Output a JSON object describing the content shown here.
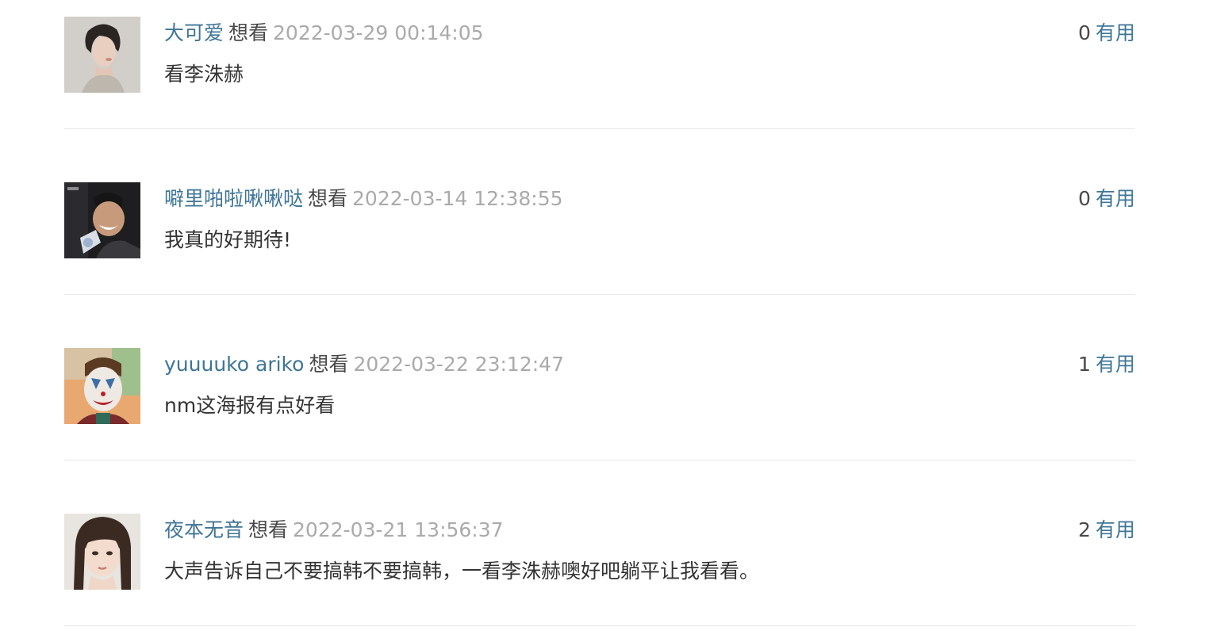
{
  "comments": [
    {
      "user": "大可爱",
      "status": "想看",
      "time": "2022-03-29 00:14:05",
      "votes": "0",
      "vote_label": "有用",
      "text": "看李洙赫",
      "avatar_icon": "avatar-photo-woman-profile"
    },
    {
      "user": "噼里啪啦啾啾哒",
      "status": "想看",
      "time": "2022-03-14 12:38:55",
      "votes": "0",
      "vote_label": "有用",
      "text": "我真的好期待!",
      "avatar_icon": "avatar-photo-laughing-man"
    },
    {
      "user": "yuuuuko ariko",
      "status": "想看",
      "time": "2022-03-22 23:12:47",
      "votes": "1",
      "vote_label": "有用",
      "text": "nm这海报有点好看",
      "avatar_icon": "avatar-photo-clown-face"
    },
    {
      "user": "夜本无音",
      "status": "想看",
      "time": "2022-03-21 13:56:37",
      "votes": "2",
      "vote_label": "有用",
      "text": "大声告诉自己不要搞韩不要搞韩，一看李洙赫噢好吧躺平让我看看。",
      "avatar_icon": "avatar-photo-woman-face"
    }
  ],
  "colors": {
    "link": "#3e7596",
    "text": "#333333",
    "muted": "#aaaaaa",
    "divider": "#e8e8e8"
  }
}
